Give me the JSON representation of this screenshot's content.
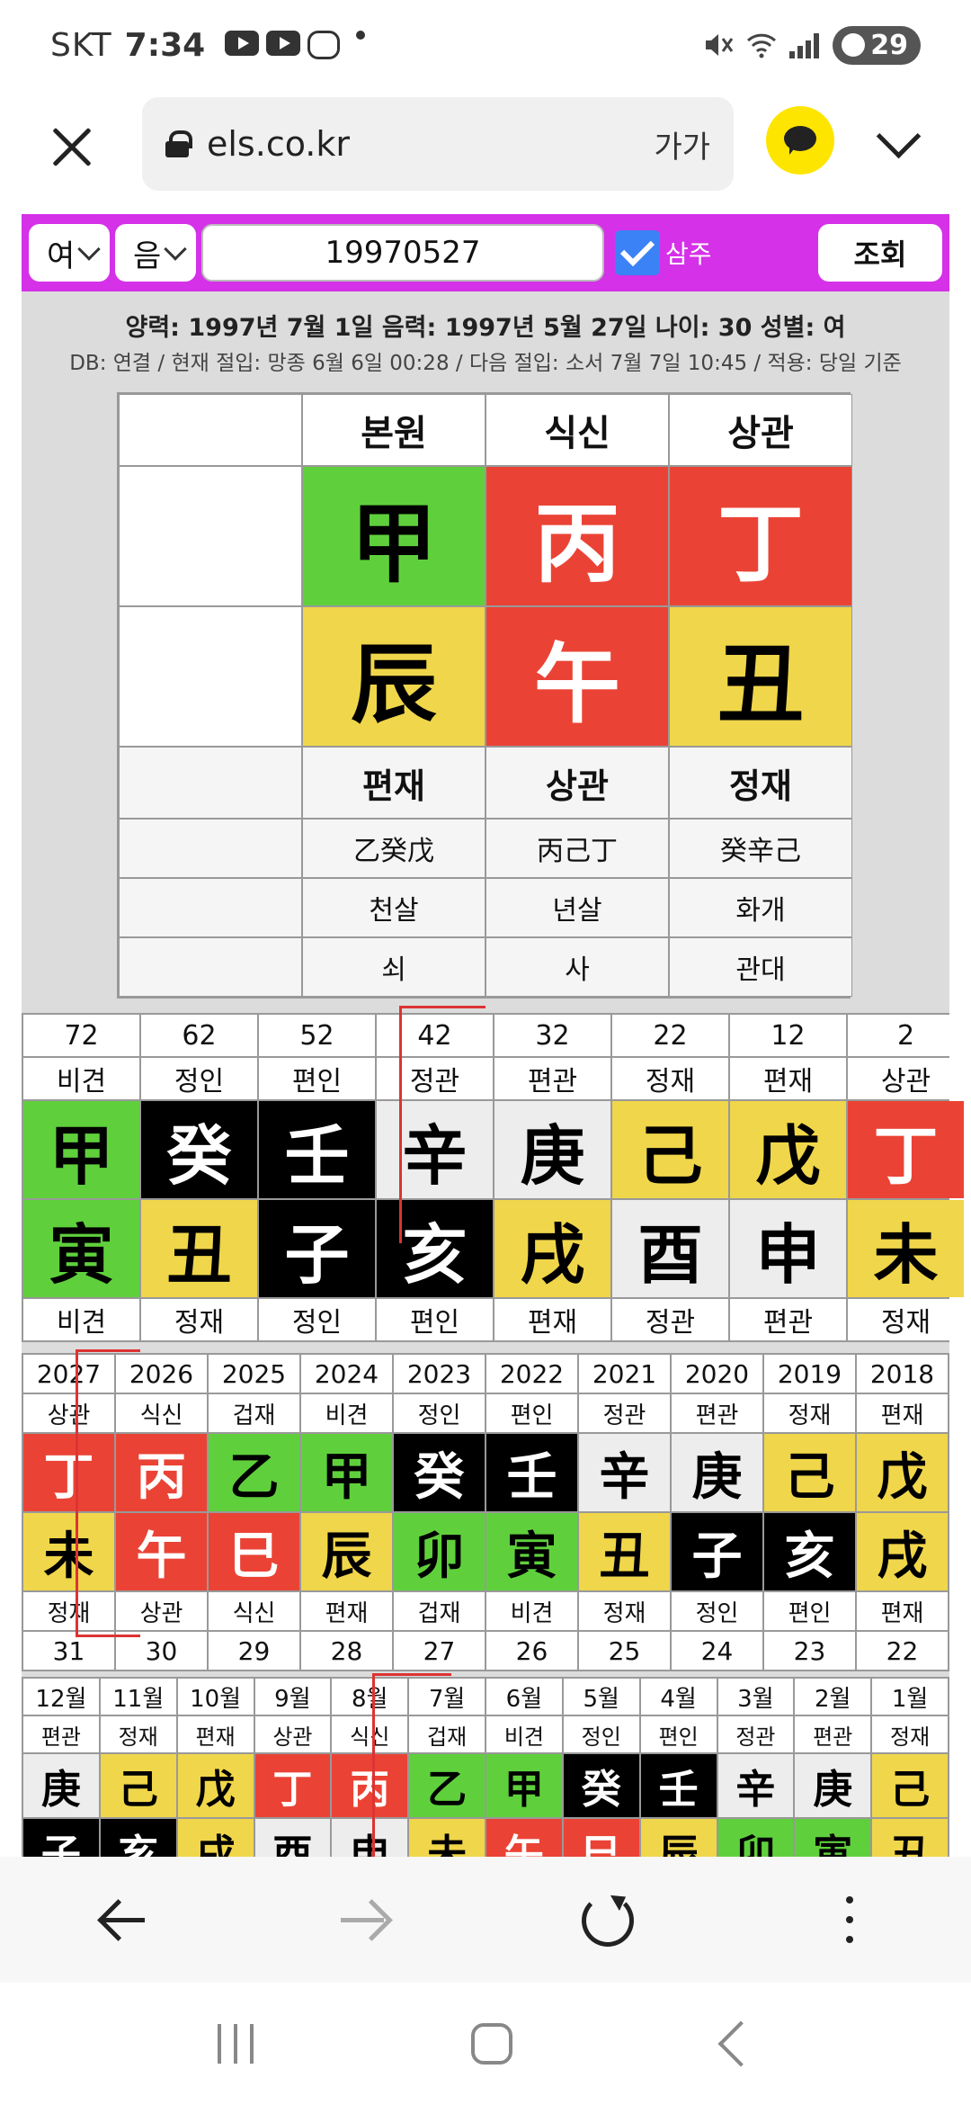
{
  "status_bar": {
    "carrier": "SKT",
    "time": "7:34",
    "battery": "29"
  },
  "browser": {
    "url": "els.co.kr",
    "reader_label": "가가"
  },
  "controls": {
    "gender": "여",
    "calendar": "음",
    "birth_date": "19970527",
    "saju_label": "삼주",
    "search_label": "조회"
  },
  "info": {
    "line1": "양력: 1997년 7월 1일 음력: 1997년 5월 27일 나이: 30 성별: 여",
    "line2": "DB: 연결 / 현재 절입: 망종 6월 6일 00:28 / 다음 절입: 소서 7월 7일 10:45 / 적용: 당일 기준"
  },
  "pillars": {
    "headers": [
      "",
      "본원",
      "식신",
      "상관"
    ],
    "stems": [
      {
        "char": "",
        "color": "#ffffff"
      },
      {
        "char": "甲",
        "color": "#5fd03c"
      },
      {
        "char": "丙",
        "color": "#ea4335"
      },
      {
        "char": "丁",
        "color": "#ea4335"
      }
    ],
    "branches": [
      {
        "char": "",
        "color": "#ffffff"
      },
      {
        "char": "辰",
        "color": "#f0d64a"
      },
      {
        "char": "午",
        "color": "#ea4335"
      },
      {
        "char": "丑",
        "color": "#f0d64a"
      }
    ],
    "ten_gods": [
      "",
      "편재",
      "상관",
      "정재"
    ],
    "hidden_stems": [
      "",
      "乙癸戊",
      "丙己丁",
      "癸辛己"
    ],
    "spirits": [
      "",
      "천살",
      "년살",
      "화개"
    ],
    "stages": [
      "",
      "쇠",
      "사",
      "관대"
    ]
  },
  "daeun": {
    "ages": [
      "72",
      "62",
      "52",
      "42",
      "32",
      "22",
      "12",
      "2"
    ],
    "stem_gods": [
      "비견",
      "정인",
      "편인",
      "정관",
      "편관",
      "정재",
      "편재",
      "상관"
    ],
    "stems": [
      {
        "char": "甲",
        "color": "#5fd03c"
      },
      {
        "char": "癸",
        "color": "#000000"
      },
      {
        "char": "壬",
        "color": "#000000"
      },
      {
        "char": "辛",
        "color": "#ededed"
      },
      {
        "char": "庚",
        "color": "#ededed"
      },
      {
        "char": "己",
        "color": "#f0d64a"
      },
      {
        "char": "戊",
        "color": "#f0d64a"
      },
      {
        "char": "丁",
        "color": "#ea4335"
      }
    ],
    "branches": [
      {
        "char": "寅",
        "color": "#5fd03c"
      },
      {
        "char": "丑",
        "color": "#f0d64a"
      },
      {
        "char": "子",
        "color": "#000000"
      },
      {
        "char": "亥",
        "color": "#000000"
      },
      {
        "char": "戌",
        "color": "#f0d64a"
      },
      {
        "char": "酉",
        "color": "#ededed"
      },
      {
        "char": "申",
        "color": "#ededed"
      },
      {
        "char": "未",
        "color": "#f0d64a"
      }
    ],
    "branch_gods": [
      "비견",
      "정재",
      "정인",
      "편인",
      "편재",
      "정관",
      "편관",
      "정재"
    ]
  },
  "seun": {
    "years": [
      "2027",
      "2026",
      "2025",
      "2024",
      "2023",
      "2022",
      "2021",
      "2020",
      "2019",
      "2018"
    ],
    "stem_gods": [
      "상관",
      "식신",
      "겁재",
      "비견",
      "정인",
      "편인",
      "정관",
      "편관",
      "정재",
      "편재"
    ],
    "stems": [
      {
        "char": "丁",
        "color": "#ea4335"
      },
      {
        "char": "丙",
        "color": "#ea4335"
      },
      {
        "char": "乙",
        "color": "#5fd03c"
      },
      {
        "char": "甲",
        "color": "#5fd03c"
      },
      {
        "char": "癸",
        "color": "#000000"
      },
      {
        "char": "壬",
        "color": "#000000"
      },
      {
        "char": "辛",
        "color": "#ededed"
      },
      {
        "char": "庚",
        "color": "#ededed"
      },
      {
        "char": "己",
        "color": "#f0d64a"
      },
      {
        "char": "戊",
        "color": "#f0d64a"
      }
    ],
    "branches": [
      {
        "char": "未",
        "color": "#f0d64a"
      },
      {
        "char": "午",
        "color": "#ea4335"
      },
      {
        "char": "巳",
        "color": "#ea4335"
      },
      {
        "char": "辰",
        "color": "#f0d64a"
      },
      {
        "char": "卯",
        "color": "#5fd03c"
      },
      {
        "char": "寅",
        "color": "#5fd03c"
      },
      {
        "char": "丑",
        "color": "#f0d64a"
      },
      {
        "char": "子",
        "color": "#000000"
      },
      {
        "char": "亥",
        "color": "#000000"
      },
      {
        "char": "戌",
        "color": "#f0d64a"
      }
    ],
    "branch_gods": [
      "정재",
      "상관",
      "식신",
      "편재",
      "겁재",
      "비견",
      "정재",
      "정인",
      "편인",
      "편재"
    ],
    "ages": [
      "31",
      "30",
      "29",
      "28",
      "27",
      "26",
      "25",
      "24",
      "23",
      "22"
    ]
  },
  "wolun": {
    "months": [
      "12월",
      "11월",
      "10월",
      "9월",
      "8월",
      "7월",
      "6월",
      "5월",
      "4월",
      "3월",
      "2월",
      "1월"
    ],
    "stem_gods": [
      "편관",
      "정재",
      "편재",
      "상관",
      "식신",
      "겁재",
      "비견",
      "정인",
      "편인",
      "정관",
      "편관",
      "정재"
    ],
    "stems": [
      {
        "char": "庚",
        "color": "#ededed"
      },
      {
        "char": "己",
        "color": "#f0d64a"
      },
      {
        "char": "戊",
        "color": "#f0d64a"
      },
      {
        "char": "丁",
        "color": "#ea4335"
      },
      {
        "char": "丙",
        "color": "#ea4335"
      },
      {
        "char": "乙",
        "color": "#5fd03c"
      },
      {
        "char": "甲",
        "color": "#5fd03c"
      },
      {
        "char": "癸",
        "color": "#000000"
      },
      {
        "char": "壬",
        "color": "#000000"
      },
      {
        "char": "辛",
        "color": "#ededed"
      },
      {
        "char": "庚",
        "color": "#ededed"
      },
      {
        "char": "己",
        "color": "#f0d64a"
      }
    ],
    "branches": [
      {
        "char": "子",
        "color": "#000000"
      },
      {
        "char": "亥",
        "color": "#000000"
      },
      {
        "char": "戌",
        "color": "#f0d64a"
      },
      {
        "char": "酉",
        "color": "#ededed"
      },
      {
        "char": "申",
        "color": "#ededed"
      },
      {
        "char": "未",
        "color": "#f0d64a"
      },
      {
        "char": "午",
        "color": "#ea4335"
      },
      {
        "char": "巳",
        "color": "#ea4335"
      },
      {
        "char": "辰",
        "color": "#f0d64a"
      },
      {
        "char": "卯",
        "color": "#5fd03c"
      },
      {
        "char": "寅",
        "color": "#5fd03c"
      },
      {
        "char": "丑",
        "color": "#f0d64a"
      }
    ]
  }
}
